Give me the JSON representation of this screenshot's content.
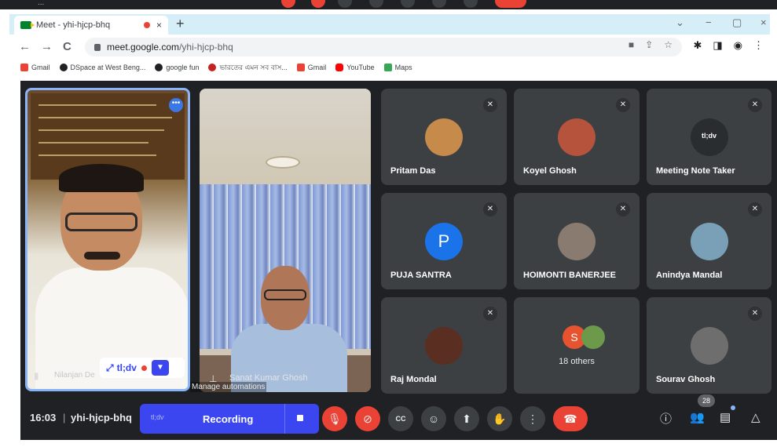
{
  "browser": {
    "tab_title": "Meet - yhi-hjcp-bhq",
    "tab_close": "×",
    "new_tab": "+",
    "url_host": "meet.google.com",
    "url_path": "/yhi-hjcp-bhq",
    "nav": {
      "back": "←",
      "forward": "→",
      "reload": "C"
    },
    "window_controls": {
      "collapse": "⌄",
      "minimize": "−",
      "restore": "▢",
      "close": "×"
    }
  },
  "bookmarks": [
    {
      "label": "Gmail",
      "color": "#ea4335"
    },
    {
      "label": "DSpace at West Beng...",
      "color": "#202124"
    },
    {
      "label": "google fun",
      "color": "#202124"
    },
    {
      "label": "ভারতের এমন সব বাস...",
      "color": "#c5221f"
    },
    {
      "label": "Gmail",
      "color": "#ea4335"
    },
    {
      "label": "YouTube",
      "color": "#ff0000"
    },
    {
      "label": "Maps",
      "color": "#34a853"
    }
  ],
  "meeting": {
    "pinned_video": {
      "name": "Nilanjan De",
      "chip_text": "tl;dv",
      "expand_icon": "⤢",
      "more_icon": "•••"
    },
    "second_video": {
      "name": "Sanat Kumar Ghosh",
      "overlay": "Manage automations"
    },
    "tiles": [
      {
        "name": "Pritam Das",
        "avatar": "photo",
        "avatar_color": "#c68a4a"
      },
      {
        "name": "Koyel Ghosh",
        "avatar": "photo",
        "avatar_color": "#b5533c"
      },
      {
        "name": "Meeting Note Taker",
        "avatar": "tl;dv",
        "avatar_color": "#2a2d30"
      },
      {
        "name": "PUJA SANTRA",
        "avatar": "P",
        "avatar_color": "#1a73e8"
      },
      {
        "name": "HOIMONTI BANERJEE",
        "avatar": "photo",
        "avatar_color": "#8a7b70"
      },
      {
        "name": "Anindya Mandal",
        "avatar": "photo",
        "avatar_color": "#7aa0b8"
      },
      {
        "name": "Raj Mondal",
        "avatar": "photo",
        "avatar_color": "#5a2e20"
      },
      {
        "name": "18 others",
        "avatar": "S",
        "avatar_color": "#e8532f"
      },
      {
        "name": "Sourav Ghosh",
        "avatar": "photo",
        "avatar_color": "#6e6e6e"
      }
    ],
    "mute_icon": "✕"
  },
  "controls": {
    "time": "16:03",
    "separator": "|",
    "meeting_code": "yhi-hjcp-bhq",
    "recording_tag": "tl;dv",
    "recording_label": "Recording",
    "participants_count": "28",
    "icons": {
      "mic": "mic-off-icon",
      "camera": "camera-off-icon",
      "captions": "CC",
      "emoji": "☺",
      "present": "⬆",
      "raise_hand": "✋",
      "more": "⋮",
      "hangup": "☎",
      "info": "ⓘ",
      "people": "👥",
      "chat": "▤",
      "activities": "△"
    },
    "accent_color": "#3b46f1",
    "danger_color": "#ea4335"
  }
}
